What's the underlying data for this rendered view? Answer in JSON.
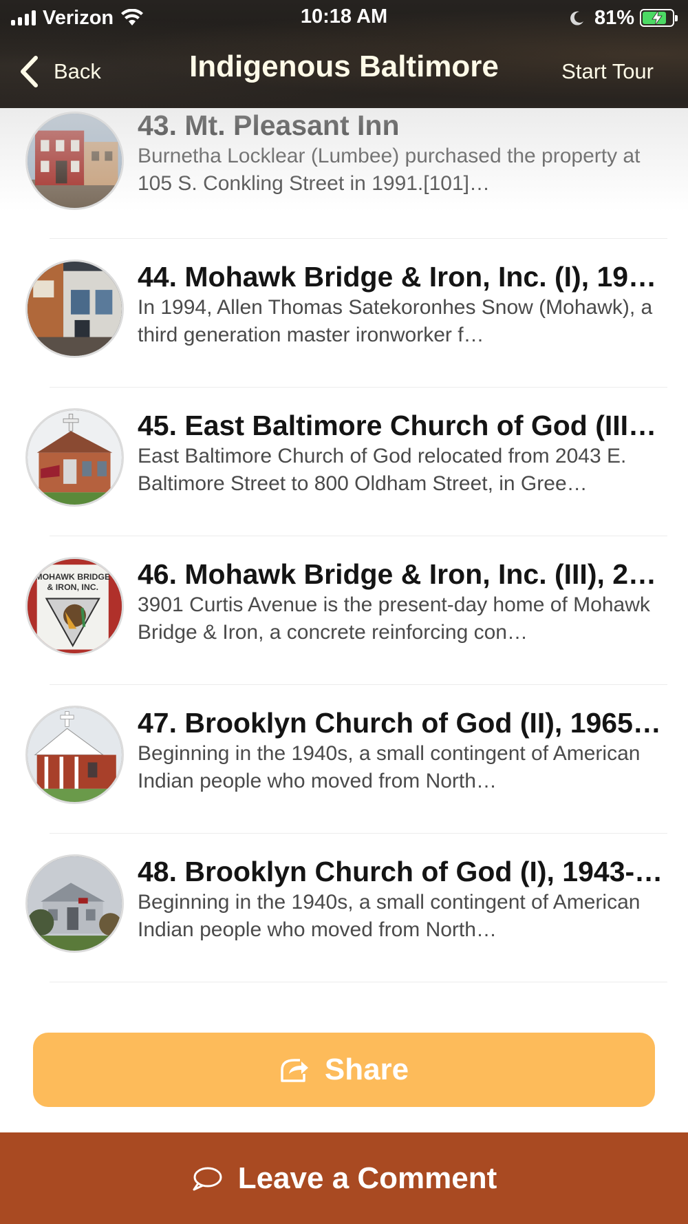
{
  "status_bar": {
    "carrier": "Verizon",
    "time": "10:18 AM",
    "battery_percent": "81%",
    "battery_level": 0.81,
    "icons": [
      "signal-icon",
      "wifi-icon",
      "moon-icon",
      "battery-charging-icon"
    ]
  },
  "nav": {
    "back_label": "Back",
    "title": "Indigenous Baltimore",
    "start_tour_label": "Start Tour"
  },
  "items": [
    {
      "title": "43. Mt. Pleasant Inn",
      "description": "Burnetha Locklear (Lumbee) purchased the property at 105 S. Conkling Street in 1991.[101]…"
    },
    {
      "title": "44. Mohawk Bridge & Iron, Inc. (I), 19…",
      "description": "In 1994, Allen Thomas Satekoronhes Snow (Mohawk), a third generation master ironworker f…"
    },
    {
      "title": "45. East Baltimore Church of God (III)…",
      "description": "East Baltimore Church of God relocated from 2043 E. Baltimore Street to 800 Oldham Street, in Gree…"
    },
    {
      "title": "46. Mohawk Bridge & Iron, Inc. (III), 2…",
      "description": "3901 Curtis Avenue is the present-day home of Mohawk Bridge & Iron, a concrete reinforcing con…",
      "thumb_sign_text": [
        "MOHAWK BRIDGE",
        "& IRON, INC."
      ]
    },
    {
      "title": "47. Brooklyn Church of God (II), 1965…",
      "description": "Beginning in the 1940s, a small contingent of American Indian people who moved from North…"
    },
    {
      "title": "48. Brooklyn Church of God (I), 1943-…",
      "description": "Beginning in the 1940s, a small contingent of American Indian people who moved from North…"
    }
  ],
  "actions": {
    "share_label": "Share",
    "comment_label": "Leave a Comment"
  },
  "colors": {
    "header_bg": "#221f1c",
    "header_text": "#fffbe8",
    "share_bg": "#fdbb5a",
    "comment_bg": "#a94a22",
    "battery_fill": "#4cd964"
  }
}
